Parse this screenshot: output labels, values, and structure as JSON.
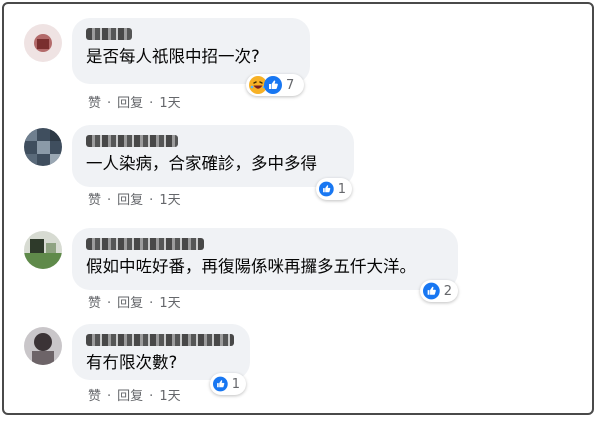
{
  "comments": [
    {
      "text": "是否每人祇限中招一次?",
      "actions": {
        "like": "赞",
        "reply": "回复",
        "time": "1天"
      },
      "reactions": {
        "icons": [
          "haha-icon",
          "like-icon"
        ],
        "count": "7"
      }
    },
    {
      "text": "一人染病，合家確診，多中多得",
      "actions": {
        "like": "赞",
        "reply": "回复",
        "time": "1天"
      },
      "reactions": {
        "icons": [
          "like-icon"
        ],
        "count": "1"
      }
    },
    {
      "text": "假如中咗好番，再復陽係咪再攞多五仟大洋。",
      "actions": {
        "like": "赞",
        "reply": "回复",
        "time": "1天"
      },
      "reactions": {
        "icons": [
          "like-icon"
        ],
        "count": "2"
      }
    },
    {
      "text": "有冇限次數?",
      "actions": {
        "like": "赞",
        "reply": "回复",
        "time": "1天"
      },
      "reactions": {
        "icons": [
          "like-icon"
        ],
        "count": "1"
      }
    }
  ],
  "colors": {
    "bubble": "#f0f2f5",
    "like_blue": "#1877f2",
    "haha_yellow": "#f7b125",
    "meta_gray": "#65676b"
  }
}
